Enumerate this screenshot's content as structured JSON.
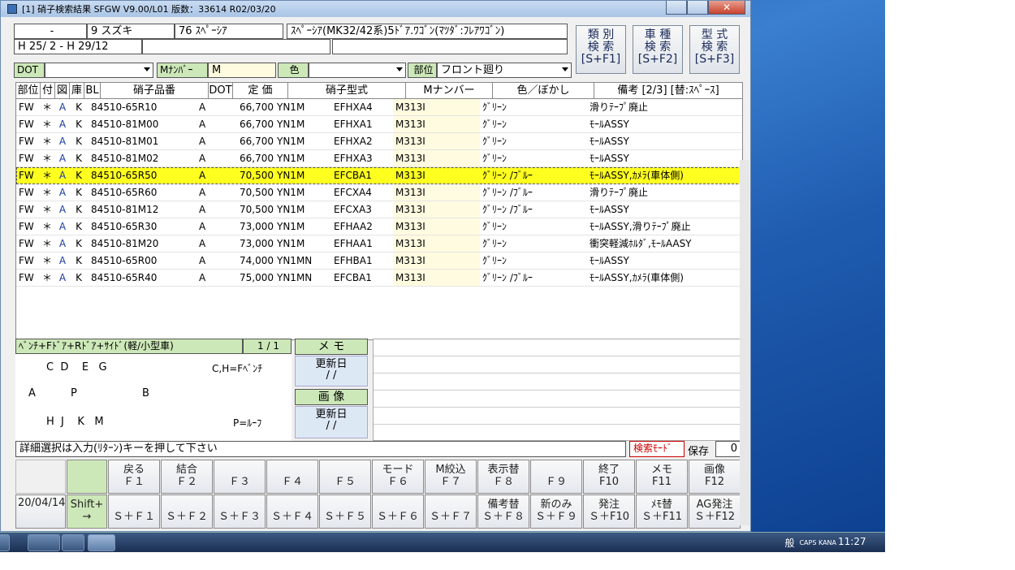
{
  "window": {
    "title": "[1] 硝子検索結果  SFGW V9.00/L01  版数：33614 R02/03/20",
    "close_glyph": "✕"
  },
  "header": {
    "row1": [
      "-",
      "9 スズキ",
      "76 ｽﾍﾟｰｼｱ",
      "ｽﾍﾟｰｼｱ(MK32/42系)5ﾄﾞｱ.ﾜｺﾞﾝ(ﾏﾂﾀﾞ:ﾌﾚｱﾜｺﾞﾝ)"
    ],
    "period": "H 25/ 2 - H 29/12",
    "dot_label": "DOT",
    "mnum_label": "Mﾅﾝﾊﾞｰ",
    "mnum_value": "M",
    "color_label": "色",
    "part_label": "部位",
    "part_value": "フロント廻り",
    "btn_type": "類 別\n検 索\n[S+F1]",
    "btn_car": "車 種\n検 索\n[S+F2]",
    "btn_model": "型 式\n検 索\n[S+F3]"
  },
  "grid": {
    "columns": [
      "部位",
      "付",
      "図",
      "庫",
      "BL",
      "硝子品番",
      "DOT",
      "定 価",
      "硝子型式",
      "Mナンバー",
      "色／ぼかし",
      "備考 [2/3] [替:ｽﾍﾟｰｽ]"
    ],
    "rows": [
      [
        "FW",
        "＊",
        "A",
        "K",
        "84510-65R10",
        "A",
        "66,700",
        "YN1M",
        "EFHXA4",
        "M313I",
        "ｸﾞﾘｰﾝ",
        "滑りﾃｰﾌﾟ廃止"
      ],
      [
        "FW",
        "＊",
        "A",
        "K",
        "84510-81M00",
        "A",
        "66,700",
        "YN1M",
        "EFHXA1",
        "M313I",
        "ｸﾞﾘｰﾝ",
        "ﾓｰﾙASSY"
      ],
      [
        "FW",
        "＊",
        "A",
        "K",
        "84510-81M01",
        "A",
        "66,700",
        "YN1M",
        "EFHXA2",
        "M313I",
        "ｸﾞﾘｰﾝ",
        "ﾓｰﾙASSY"
      ],
      [
        "FW",
        "＊",
        "A",
        "K",
        "84510-81M02",
        "A",
        "66,700",
        "YN1M",
        "EFHXA3",
        "M313I",
        "ｸﾞﾘｰﾝ",
        "ﾓｰﾙASSY"
      ],
      [
        "FW",
        "＊",
        "A",
        "K",
        "84510-65R50",
        "A",
        "70,500",
        "YN1M",
        "EFCBA1",
        "M313I",
        "ｸﾞﾘｰﾝ /ﾌﾞﾙｰ",
        "ﾓｰﾙASSY,ｶﾒﾗ(車体側)"
      ],
      [
        "FW",
        "＊",
        "A",
        "K",
        "84510-65R60",
        "A",
        "70,500",
        "YN1M",
        "EFCXA4",
        "M313I",
        "ｸﾞﾘｰﾝ /ﾌﾞﾙｰ",
        "滑りﾃｰﾌﾟ廃止"
      ],
      [
        "FW",
        "＊",
        "A",
        "K",
        "84510-81M12",
        "A",
        "70,500",
        "YN1M",
        "EFCXA3",
        "M313I",
        "ｸﾞﾘｰﾝ /ﾌﾞﾙｰ",
        "ﾓｰﾙASSY"
      ],
      [
        "FW",
        "＊",
        "A",
        "K",
        "84510-65R30",
        "A",
        "73,000",
        "YN1M",
        "EFHAA2",
        "M313I",
        "ｸﾞﾘｰﾝ",
        "ﾓｰﾙASSY,滑りﾃｰﾌﾟ廃止"
      ],
      [
        "FW",
        "＊",
        "A",
        "K",
        "84510-81M20",
        "A",
        "73,000",
        "YN1M",
        "EFHAA1",
        "M313I",
        "ｸﾞﾘｰﾝ",
        "衝突軽減ﾎﾙﾀﾞ,ﾓｰﾙAASY"
      ],
      [
        "FW",
        "＊",
        "A",
        "K",
        "84510-65R00",
        "A",
        "74,000",
        "YN1MN",
        "EFHBA1",
        "M313I",
        "ｸﾞﾘｰﾝ",
        "ﾓｰﾙASSY"
      ],
      [
        "FW",
        "＊",
        "A",
        "K",
        "84510-65R40",
        "A",
        "75,000",
        "YN1MN",
        "EFCBA1",
        "M313I",
        "ｸﾞﾘｰﾝ /ﾌﾞﾙｰ",
        "ﾓｰﾙASSY,ｶﾒﾗ(車体側)"
      ]
    ],
    "selected_index": 4
  },
  "detail": {
    "title": "ﾍﾞﾝﾁ+Fﾄﾞｱ+Rﾄﾞｱ+ｻｲﾄﾞ(軽/小型車)",
    "page": "1 / 1",
    "l1": "C  D    E   G",
    "l1r": "C,H=Fﾍﾞﾝﾁ",
    "l2a": "A",
    "l2b": "P",
    "l2c": "B",
    "l3": "H  J    K   M",
    "l3r": "P=ﾙｰﾌ",
    "memo": "メ モ",
    "upd1": "更新日\n/ /",
    "image": "画 像",
    "upd2": "更新日\n/ /"
  },
  "status": {
    "message": "詳細選択は入力(ﾘﾀｰﾝ)キーを押して下さい",
    "mode": "検索ﾓｰﾄﾞ",
    "save_label": "保存",
    "save_value": "0"
  },
  "fkeys": {
    "date": "20/04/14",
    "shift": "Shift+\n→",
    "top": [
      "戻る\nＦ１",
      "結合\nＦ２",
      "\nＦ３",
      "\nＦ４",
      "\nＦ５",
      "モード\nＦ６",
      "M絞込\nＦ７",
      "表示替\nＦ８",
      "\nＦ９",
      "終了\nF10",
      "メモ\nF11",
      "画像\nF12"
    ],
    "bottom": [
      "\nＳ＋Ｆ１",
      "\nＳ＋Ｆ２",
      "\nＳ＋Ｆ３",
      "\nＳ＋Ｆ４",
      "\nＳ＋Ｆ５",
      "\nＳ＋Ｆ６",
      "\nＳ＋Ｆ７",
      "備考替\nＳ＋Ｆ８",
      "新のみ\nＳ＋Ｆ９",
      "発注\nＳ＋F10",
      "ﾒﾓ替\nＳ＋F11",
      "AG発注\nＳ＋F12"
    ]
  },
  "taskbar": {
    "tray_text": "般",
    "caps": "CAPS KANA",
    "clock": "11:27"
  }
}
